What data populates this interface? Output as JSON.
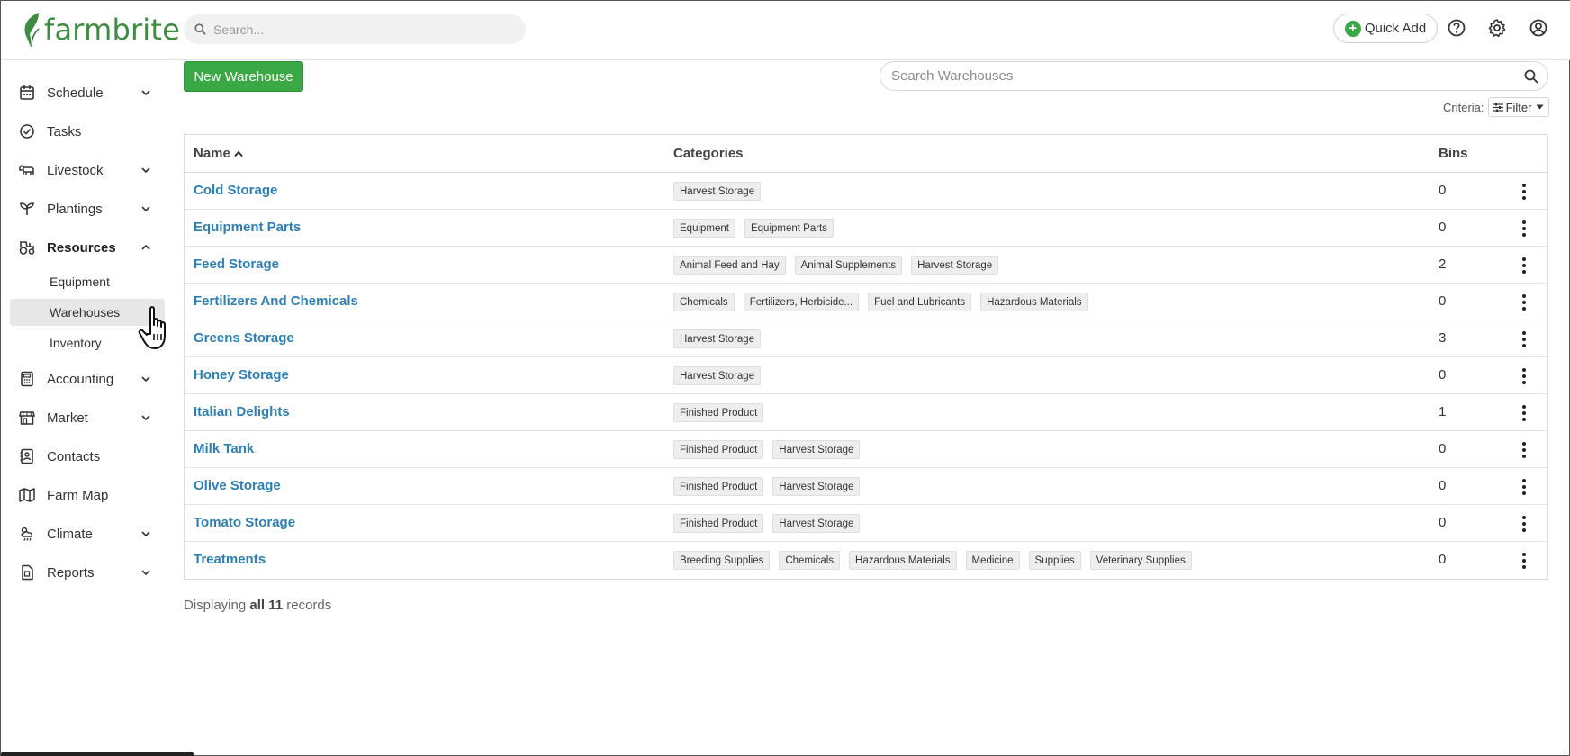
{
  "app": {
    "logo_text": "farmbrite",
    "search_placeholder": "Search...",
    "quick_add_label": "Quick Add"
  },
  "colors": {
    "brand_green": "#3aa845",
    "link_blue": "#2e7fb3"
  },
  "sidebar": {
    "items": [
      {
        "label": "Schedule",
        "icon": "calendar-icon",
        "expandable": true
      },
      {
        "label": "Tasks",
        "icon": "check-circle-icon",
        "expandable": false
      },
      {
        "label": "Livestock",
        "icon": "cow-icon",
        "expandable": true
      },
      {
        "label": "Plantings",
        "icon": "sprout-icon",
        "expandable": true
      },
      {
        "label": "Resources",
        "icon": "tractor-icon",
        "expandable": true,
        "expanded": true
      },
      {
        "label": "Accounting",
        "icon": "calculator-icon",
        "expandable": true
      },
      {
        "label": "Market",
        "icon": "storefront-icon",
        "expandable": true
      },
      {
        "label": "Contacts",
        "icon": "contact-card-icon",
        "expandable": false
      },
      {
        "label": "Farm Map",
        "icon": "map-icon",
        "expandable": false
      },
      {
        "label": "Climate",
        "icon": "weather-icon",
        "expandable": true
      },
      {
        "label": "Reports",
        "icon": "report-icon",
        "expandable": true
      }
    ],
    "resources_sub": [
      {
        "label": "Equipment"
      },
      {
        "label": "Warehouses",
        "selected": true
      },
      {
        "label": "Inventory"
      }
    ]
  },
  "toolbar": {
    "new_button_label": "New Warehouse",
    "search_placeholder": "Search Warehouses",
    "criteria_label": "Criteria:",
    "filter_label": "Filter"
  },
  "table": {
    "columns": [
      "Name",
      "Categories",
      "Bins"
    ],
    "rows": [
      {
        "name": "Cold Storage",
        "categories": [
          "Harvest Storage"
        ],
        "bins": "0"
      },
      {
        "name": "Equipment Parts",
        "categories": [
          "Equipment",
          "Equipment Parts"
        ],
        "bins": "0"
      },
      {
        "name": "Feed Storage",
        "categories": [
          "Animal Feed and Hay",
          "Animal Supplements",
          "Harvest Storage"
        ],
        "bins": "2"
      },
      {
        "name": "Fertilizers And Chemicals",
        "categories": [
          "Chemicals",
          "Fertilizers, Herbicide...",
          "Fuel and Lubricants",
          "Hazardous Materials"
        ],
        "bins": "0"
      },
      {
        "name": "Greens Storage",
        "categories": [
          "Harvest Storage"
        ],
        "bins": "3"
      },
      {
        "name": "Honey Storage",
        "categories": [
          "Harvest Storage"
        ],
        "bins": "0"
      },
      {
        "name": "Italian Delights",
        "categories": [
          "Finished Product"
        ],
        "bins": "1"
      },
      {
        "name": "Milk Tank",
        "categories": [
          "Finished Product",
          "Harvest Storage"
        ],
        "bins": "0"
      },
      {
        "name": "Olive Storage",
        "categories": [
          "Finished Product",
          "Harvest Storage"
        ],
        "bins": "0"
      },
      {
        "name": "Tomato Storage",
        "categories": [
          "Finished Product",
          "Harvest Storage"
        ],
        "bins": "0"
      },
      {
        "name": "Treatments",
        "categories": [
          "Breeding Supplies",
          "Chemicals",
          "Hazardous Materials",
          "Medicine",
          "Supplies",
          "Veterinary Supplies"
        ],
        "bins": "0"
      }
    ]
  },
  "footer": {
    "prefix": "Displaying",
    "count_text": "all 11",
    "suffix": "records"
  }
}
